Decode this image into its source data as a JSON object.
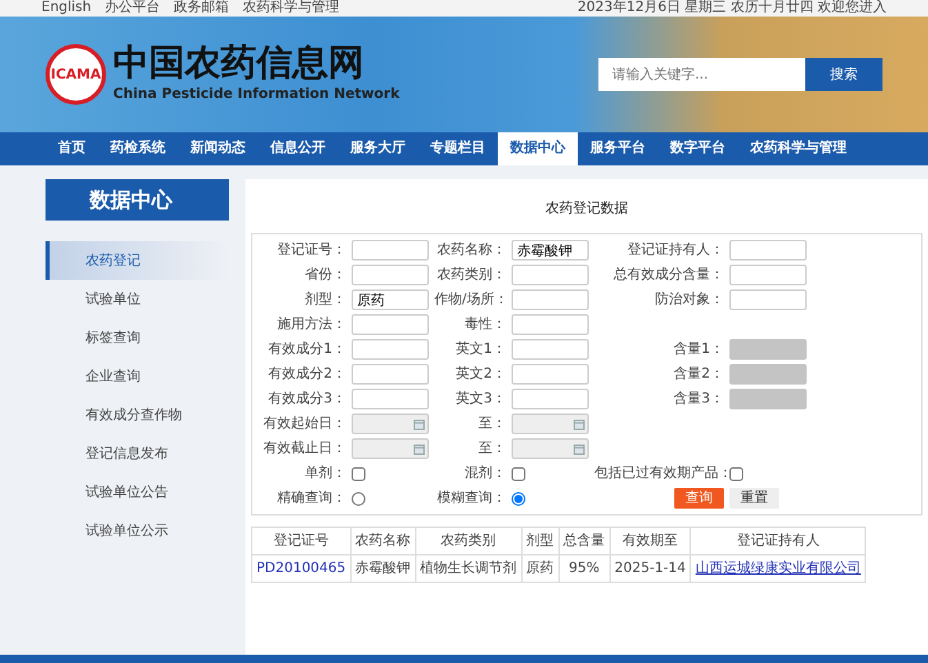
{
  "top_bar": {
    "links": [
      "English",
      "办公平台",
      "政务邮箱",
      "农药科学与管理"
    ],
    "date": "2023年12月6日 星期三 农历十月廿四 欢迎您进入"
  },
  "header": {
    "logo_text": "ICAMA",
    "title": "中国农药信息网",
    "subtitle": "China Pesticide Information Network",
    "search": {
      "placeholder": "请输入关键字...",
      "button": "搜索"
    }
  },
  "nav": [
    {
      "label": "首页",
      "selected": false
    },
    {
      "label": "药检系统",
      "selected": false
    },
    {
      "label": "新闻动态",
      "selected": false
    },
    {
      "label": "信息公开",
      "selected": false
    },
    {
      "label": "服务大厅",
      "selected": false
    },
    {
      "label": "专题栏目",
      "selected": false
    },
    {
      "label": "数据中心",
      "selected": true
    },
    {
      "label": "服务平台",
      "selected": false
    },
    {
      "label": "数字平台",
      "selected": false
    },
    {
      "label": "农药科学与管理",
      "selected": false
    }
  ],
  "sidebar": {
    "title": "数据中心",
    "items": [
      {
        "label": "农药登记",
        "selected": true
      },
      {
        "label": "试验单位",
        "selected": false
      },
      {
        "label": "标签查询",
        "selected": false
      },
      {
        "label": "企业查询",
        "selected": false
      },
      {
        "label": "有效成分查作物",
        "selected": false
      },
      {
        "label": "登记信息发布",
        "selected": false
      },
      {
        "label": "试验单位公告",
        "selected": false
      },
      {
        "label": "试验单位公示",
        "selected": false
      }
    ]
  },
  "main": {
    "title": "农药登记数据",
    "form_rows": [
      [
        {
          "kind": "text",
          "label": "登记证号："
        },
        {
          "kind": "text",
          "label": "农药名称：",
          "value": "赤霉酸钾"
        },
        {
          "kind": "text",
          "label": "登记证持有人："
        }
      ],
      [
        {
          "kind": "text",
          "label": "省份："
        },
        {
          "kind": "text",
          "label": "农药类别："
        },
        {
          "kind": "text",
          "label": "总有效成分含量："
        }
      ],
      [
        {
          "kind": "text",
          "label": "剂型：",
          "value": "原药"
        },
        {
          "kind": "text",
          "label": "作物/场所："
        },
        {
          "kind": "text",
          "label": "防治对象："
        }
      ],
      [
        {
          "kind": "text",
          "label": "施用方法："
        },
        {
          "kind": "text",
          "label": "毒性："
        },
        {
          "kind": "blank"
        }
      ],
      [
        {
          "kind": "text",
          "label": "有效成分1："
        },
        {
          "kind": "text",
          "label": "英文1："
        },
        {
          "kind": "readonly",
          "label": "含量1："
        }
      ],
      [
        {
          "kind": "text",
          "label": "有效成分2："
        },
        {
          "kind": "text",
          "label": "英文2："
        },
        {
          "kind": "readonly",
          "label": "含量2："
        }
      ],
      [
        {
          "kind": "text",
          "label": "有效成分3："
        },
        {
          "kind": "text",
          "label": "英文3："
        },
        {
          "kind": "readonly",
          "label": "含量3："
        }
      ],
      [
        {
          "kind": "date",
          "label": "有效起始日："
        },
        {
          "kind": "date",
          "label": "至："
        },
        {
          "kind": "blank"
        }
      ],
      [
        {
          "kind": "date",
          "label": "有效截止日："
        },
        {
          "kind": "date",
          "label": "至："
        },
        {
          "kind": "blank"
        }
      ],
      [
        {
          "kind": "checkbox",
          "label": "单剂：",
          "checked": false
        },
        {
          "kind": "checkbox",
          "label": "混剂：",
          "checked": false
        },
        {
          "kind": "checkbox",
          "label": "包括已过有效期产品：",
          "checked": false
        }
      ],
      [
        {
          "kind": "radio",
          "label": "精确查询：",
          "selected": false
        },
        {
          "kind": "radio",
          "label": "模糊查询：",
          "selected": true
        },
        {
          "kind": "buttons",
          "buttons": [
            {
              "label": "查询",
              "kind": "primary"
            },
            {
              "label": "重置",
              "kind": "secondary"
            }
          ]
        }
      ]
    ],
    "results": {
      "columns": [
        "登记证号",
        "农药名称",
        "农药类别",
        "剂型",
        "总含量",
        "有效期至",
        "登记证持有人"
      ],
      "rows": [
        [
          "PD20100465",
          "赤霉酸钾",
          "植物生长调节剂",
          "原药",
          "95%",
          "2025-1-14",
          "山西运城绿康实业有限公司"
        ]
      ]
    }
  }
}
